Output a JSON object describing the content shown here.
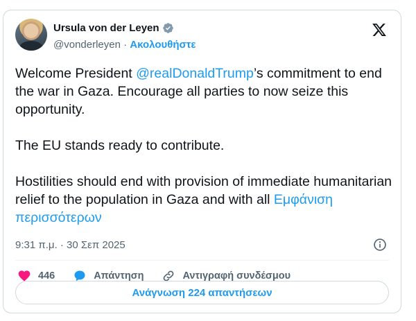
{
  "author": {
    "name": "Ursula von der Leyen",
    "handle": "@vonderleyen",
    "separator": " · ",
    "follow_label": "Ακολουθήστε"
  },
  "tweet": {
    "text_before": "Welcome President ",
    "mention": "@realDonaldTrump",
    "text_after": "’s commitment to end the war in Gaza.  Encourage all parties to now seize this opportunity.\n\nThe EU stands ready to contribute.\n\nHostilities should end with provision of immediate humanitarian relief to the population in Gaza and with all ",
    "show_more": "Εμφάνιση περισσότερων"
  },
  "meta": {
    "timestamp": "9:31 π.μ. · 30 Σεπ 2025"
  },
  "actions": {
    "likes": "446",
    "reply_label": "Απάντηση",
    "copy_link_label": "Αντιγραφή συνδέσμου"
  },
  "replies_button": "Ανάγνωση 224 απαντήσεων",
  "colors": {
    "accent": "#1d9bf0",
    "like": "#f91880",
    "muted": "#536471"
  },
  "icons": [
    "verified-badge-icon",
    "x-logo-icon",
    "info-icon",
    "heart-icon",
    "reply-bubble-icon",
    "link-icon"
  ]
}
